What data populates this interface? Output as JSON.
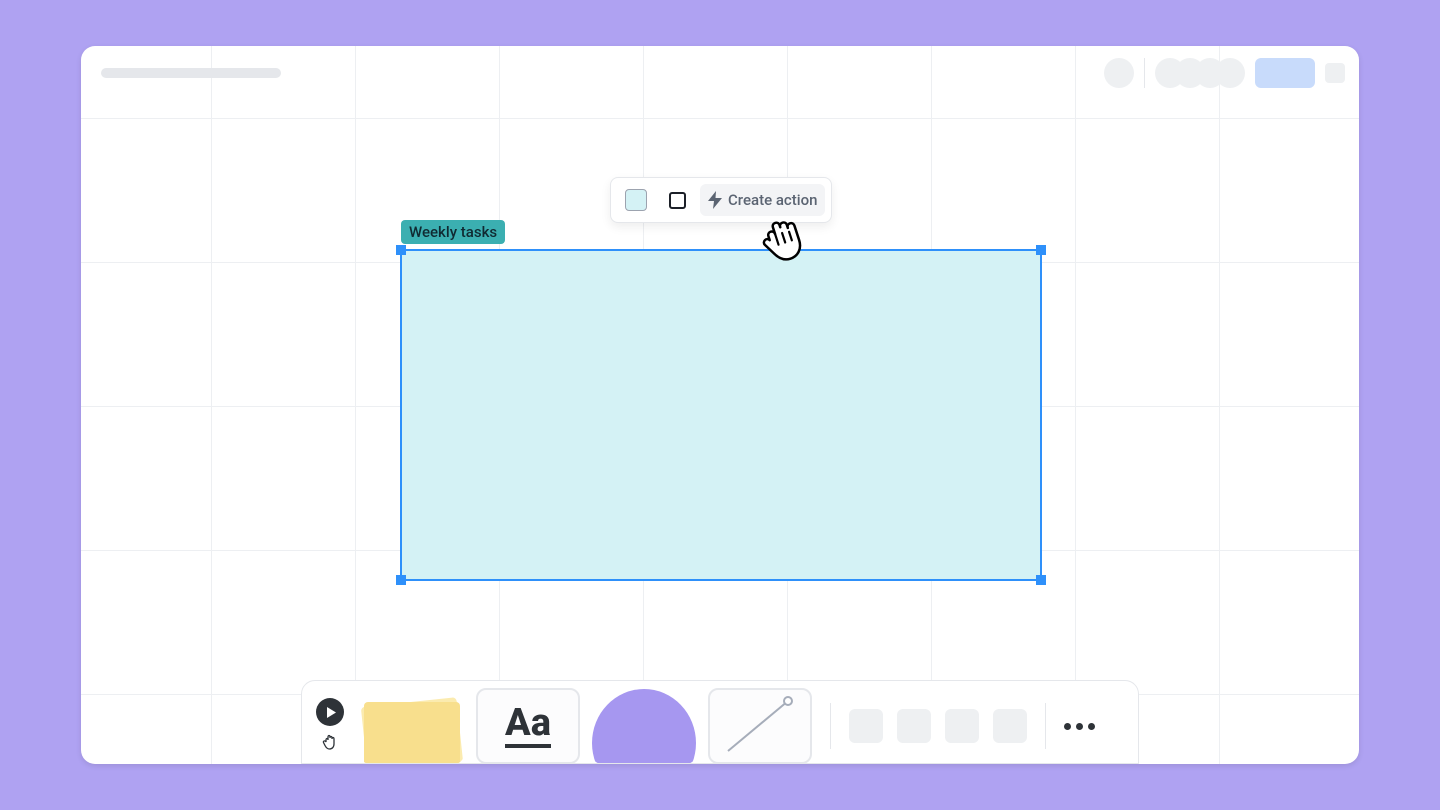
{
  "selection_label": "Weekly tasks",
  "context_toolbar": {
    "create_action_label": "Create action"
  },
  "bottom_toolbar": {
    "text_tool_label": "Aa"
  }
}
